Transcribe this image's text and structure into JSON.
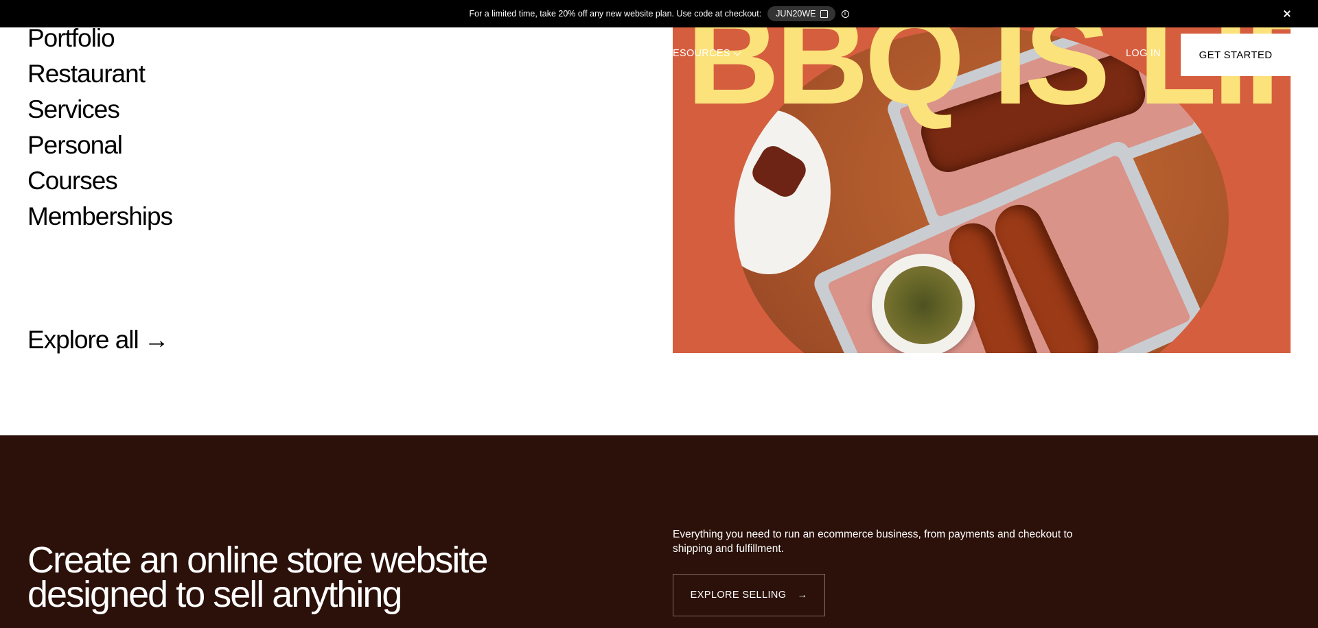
{
  "promo": {
    "text": "For a limited time, take 20% off any new website plan. Use code at checkout:",
    "code": "JUN20WE"
  },
  "categories": [
    "Portfolio",
    "Restaurant",
    "Services",
    "Personal",
    "Courses",
    "Memberships"
  ],
  "explore_all": {
    "label": "Explore all",
    "arrow": "→"
  },
  "hero": {
    "headline": "BBQ IS LIFE"
  },
  "nav": {
    "resources_label": "ESOURCES",
    "login_label": "LOG IN",
    "get_started_label": "GET STARTED"
  },
  "store": {
    "heading": "Create an online store website designed to sell anything",
    "description": "Everything you need to run an ecommerce business, from payments and checkout to shipping and fulfillment.",
    "cta_label": "EXPLORE SELLING",
    "cta_arrow": "→"
  },
  "colors": {
    "banner_bg": "#000000",
    "hero_bg": "#d55e3f",
    "hero_text": "#fbe27a",
    "dark_section_bg": "#2b110a"
  }
}
